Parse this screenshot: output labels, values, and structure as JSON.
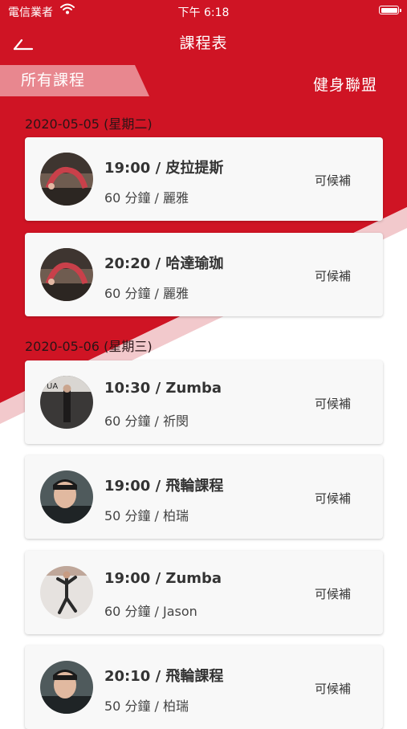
{
  "status_bar": {
    "carrier": "電信業者",
    "time": "下午 6:18"
  },
  "nav": {
    "title": "課程表",
    "back_icon": "back-arrow-icon"
  },
  "tabs": {
    "all_classes": "所有課程",
    "fitness_league": "健身聯盟"
  },
  "colors": {
    "primary_red": "#cf1424",
    "tab_active_bg": "#e8878f",
    "card_bg": "#f8f8f8"
  },
  "sections": [
    {
      "date": "2020-05-05 (星期二)",
      "classes": [
        {
          "title": "19:00 / 皮拉提斯",
          "subtitle": "60 分鐘 / 麗雅",
          "status": "可候補"
        },
        {
          "title": "20:20 / 哈達瑜珈",
          "subtitle": "60 分鐘 / 麗雅",
          "status": "可候補"
        }
      ]
    },
    {
      "date": "2020-05-06 (星期三)",
      "classes": [
        {
          "title": "10:30 / Zumba",
          "subtitle": "60 分鐘 / 祈閔",
          "status": "可候補"
        },
        {
          "title": "19:00 / 飛輪課程",
          "subtitle": "50 分鐘 / 柏瑞",
          "status": "可候補"
        },
        {
          "title": "19:00 / Zumba",
          "subtitle": "60 分鐘 / Jason",
          "status": "可候補"
        },
        {
          "title": "20:10 / 飛輪課程",
          "subtitle": "50 分鐘 / 柏瑞",
          "status": "可候補"
        }
      ]
    }
  ]
}
